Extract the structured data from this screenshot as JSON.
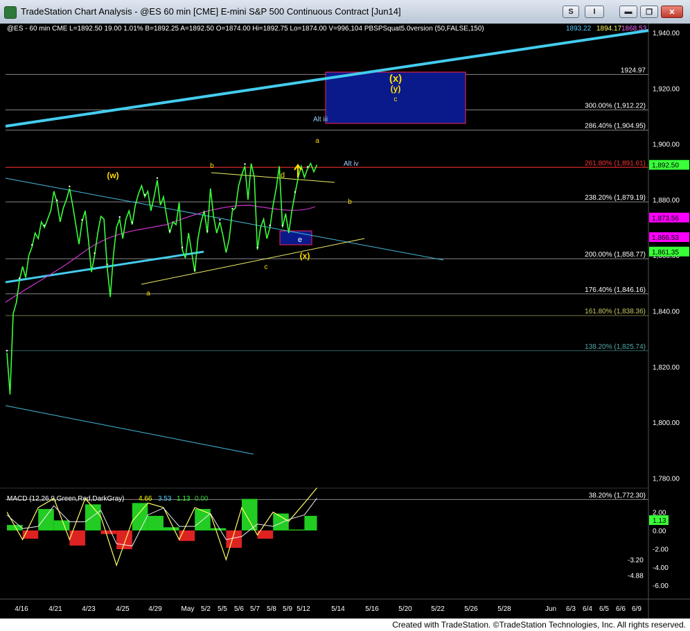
{
  "window": {
    "title": "TradeStation Chart Analysis - @ES 60 min [CME] E-mini S&P 500 Continuous Contract [Jun14]",
    "buttons": {
      "s": "S",
      "i": "I",
      "minimize": "▬",
      "restore": "❐",
      "close": "✕"
    }
  },
  "header": {
    "symbol_info": "@ES - 60 min  CME  L=1892.50  19.00  1.01%  B=1892.25  A=1892.50  O=1874.00  Hi=1892.75  Lo=1874.00  V=996,104  PBSPSquat5.0version (50,FALSE,150)",
    "indicator_values": [
      "1893.22",
      "1894.17",
      "1868.53"
    ]
  },
  "price_axis": {
    "ticks": [
      "1,940.00",
      "1,920.00",
      "1,900.00",
      "1,880.00",
      "1,860.00",
      "1,840.00",
      "1,820.00",
      "1,800.00",
      "1,780.00"
    ],
    "tags": [
      {
        "label": "1,892.50",
        "bg": "#39ff39",
        "fg": "#000000"
      },
      {
        "label": "1,873.56",
        "bg": "#ff00ff",
        "fg": "#000000"
      },
      {
        "label": "1,866.53",
        "bg": "#ff00ff",
        "fg": "#000000"
      },
      {
        "label": "1,861.35",
        "bg": "#39ff39",
        "fg": "#000000"
      }
    ]
  },
  "levels": [
    {
      "label": "1924.97",
      "price": 1924.97,
      "color": "#ffffff"
    },
    {
      "label": "300.00% (1,912.22)",
      "price": 1912.22,
      "color": "#ffffff"
    },
    {
      "label": "286.40% (1,904.95)",
      "price": 1904.95,
      "color": "#ffffff"
    },
    {
      "label": "261.80% (1,891.61)",
      "price": 1891.61,
      "color": "#ff3333"
    },
    {
      "label": "238.20% (1,879.19)",
      "price": 1879.19,
      "color": "#ffffff"
    },
    {
      "label": "200.00% (1,858.77)",
      "price": 1858.77,
      "color": "#ffffff"
    },
    {
      "label": "176.40% (1,846.16)",
      "price": 1846.16,
      "color": "#ffffff"
    },
    {
      "label": "161.80% (1,838.36)",
      "price": 1838.36,
      "color": "#cccc66"
    },
    {
      "label": "138.20% (1,825.74)",
      "price": 1825.74,
      "color": "#55aaaa"
    },
    {
      "label": "38.20% (1,772.30)",
      "price": 1772.3,
      "color": "#ffffff"
    }
  ],
  "annotations": {
    "x_cap": "(x)",
    "y_cap": "(y)",
    "c_top": "c",
    "alt_iii": "Alt iii",
    "alt_iv": "Alt iv",
    "a_top": "a",
    "w": "(w)",
    "b_left": "b",
    "d": "d",
    "b_right": "b",
    "e": "e",
    "x_low": "(x)",
    "c_low": "c",
    "a_low": "a"
  },
  "macd": {
    "label": "MACD (12,26,9,Green,Red,DarkGray)",
    "values": [
      {
        "v": "4.66",
        "color": "#ffff00"
      },
      {
        "v": "3.53",
        "color": "#55ccff"
      },
      {
        "v": "1.13",
        "color": "#39ff39"
      },
      {
        "v": "0.00",
        "color": "#39cc39"
      }
    ],
    "axis": [
      {
        "label": "2.00",
        "value": 2.0
      },
      {
        "label": "0.00",
        "value": 0.0
      },
      {
        "label": "-2.00",
        "value": -2.0
      },
      {
        "label": "-4.00",
        "value": -4.0
      },
      {
        "label": "-6.00",
        "value": -6.0
      }
    ],
    "tags": [
      {
        "label": "1.13",
        "value": 1.13
      },
      {
        "label": "-3.20",
        "value": -3.2
      },
      {
        "label": "-4.88",
        "value": -4.88
      }
    ]
  },
  "date_axis": [
    "4/16",
    "4/21",
    "4/23",
    "4/25",
    "4/29",
    "May",
    "5/2",
    "5/5",
    "5/6",
    "5/7",
    "5/8",
    "5/9",
    "5/12",
    "5/14",
    "5/16",
    "5/20",
    "5/22",
    "5/26",
    "5/28",
    "Jun",
    "6/3",
    "6/4",
    "6/5",
    "6/6",
    "6/9"
  ],
  "footer": "Created with TradeStation. ©TradeStation Technologies, Inc. All rights reserved.",
  "chart_data": {
    "type": "line",
    "title": "@ES 60 min [CME] E-mini S&P 500 Continuous Contract [Jun14]",
    "ylim": [
      1766,
      1945
    ],
    "series": [
      {
        "name": "@ES - 60 min",
        "color": "#39ff39",
        "x": [
          0,
          1,
          2,
          3,
          4,
          5,
          6,
          7,
          8,
          9,
          10,
          11,
          12,
          13,
          14,
          15,
          16,
          17,
          18,
          19,
          20,
          21,
          22,
          23,
          24,
          25,
          26,
          27,
          28,
          29,
          30,
          31,
          32,
          33,
          34,
          35,
          36,
          37,
          38,
          39,
          40,
          41,
          42,
          43,
          44,
          45,
          46,
          47,
          48,
          49,
          50,
          51,
          52,
          53,
          54,
          55,
          56,
          57,
          58,
          59,
          60,
          61,
          62,
          63,
          64,
          65,
          66,
          67,
          68,
          69,
          70,
          71,
          72,
          73,
          74,
          75,
          76,
          77,
          78,
          79,
          80,
          81,
          82,
          83,
          84,
          85,
          86,
          87,
          88,
          89,
          90,
          91,
          92,
          93,
          94,
          95,
          96,
          97,
          98,
          99
        ],
        "values": [
          1825,
          1810,
          1839,
          1843,
          1851,
          1856,
          1852,
          1860,
          1863,
          1868,
          1866,
          1872,
          1870,
          1873,
          1876,
          1883,
          1879,
          1872,
          1877,
          1880,
          1884,
          1878,
          1871,
          1864,
          1872,
          1876,
          1866,
          1854,
          1860,
          1868,
          1874,
          1873,
          1856,
          1845,
          1860,
          1870,
          1873,
          1866,
          1873,
          1876,
          1871,
          1878,
          1882,
          1885,
          1881,
          1883,
          1876,
          1881,
          1887,
          1878,
          1881,
          1874,
          1868,
          1872,
          1871,
          1879,
          1862,
          1859,
          1868,
          1861,
          1854,
          1866,
          1872,
          1876,
          1868,
          1884,
          1874,
          1868,
          1872,
          1867,
          1861,
          1866,
          1876,
          1877,
          1885,
          1889,
          1892,
          1880,
          1893,
          1888,
          1862,
          1870,
          1873,
          1866,
          1870,
          1878,
          1884,
          1892,
          1870,
          1875,
          1868,
          1876,
          1882,
          1888,
          1892,
          1888,
          1891,
          1893,
          1890,
          1892.5
        ]
      },
      {
        "name": "MACD",
        "color": "#ffff66",
        "x": [
          0,
          5,
          10,
          15,
          20,
          25,
          30,
          35,
          40,
          45,
          50,
          55,
          60,
          65,
          70,
          75,
          80,
          85,
          90,
          95,
          99
        ],
        "values": [
          2.0,
          -1.0,
          2.5,
          3.5,
          -1.0,
          3.5,
          1.5,
          -3.8,
          1.0,
          3.0,
          2.5,
          -1.0,
          2.5,
          1.8,
          -3.2,
          2.5,
          -0.5,
          2.0,
          1.0,
          3.0,
          4.66
        ]
      }
    ]
  }
}
